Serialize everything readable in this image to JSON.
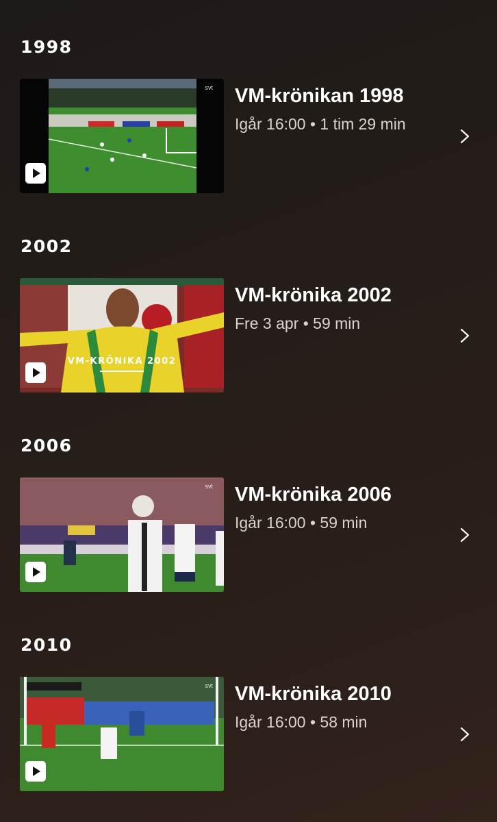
{
  "sections": [
    {
      "year": "1998",
      "title": "VM-krönikan 1998",
      "meta": "Igår 16:00 • 1 tim 29 min",
      "thumb_icon": "play-icon",
      "channel_logo": "svt"
    },
    {
      "year": "2002",
      "title": "VM-krönika 2002",
      "meta": "Fre 3 apr • 59 min",
      "thumb_icon": "play-icon",
      "thumb_caption": "VM-KRÖNIKA 2002"
    },
    {
      "year": "2006",
      "title": "VM-krönika 2006",
      "meta": "Igår 16:00 • 59 min",
      "thumb_icon": "play-icon",
      "channel_logo": "svt"
    },
    {
      "year": "2010",
      "title": "VM-krönika 2010",
      "meta": "Igår 16:00 • 58 min",
      "thumb_icon": "play-icon",
      "channel_logo": "svt"
    }
  ],
  "colors": {
    "background": "#251d19",
    "text": "#ffffff",
    "meta_text": "#d9d4d0",
    "pitch_green": "#3f8a2e"
  }
}
